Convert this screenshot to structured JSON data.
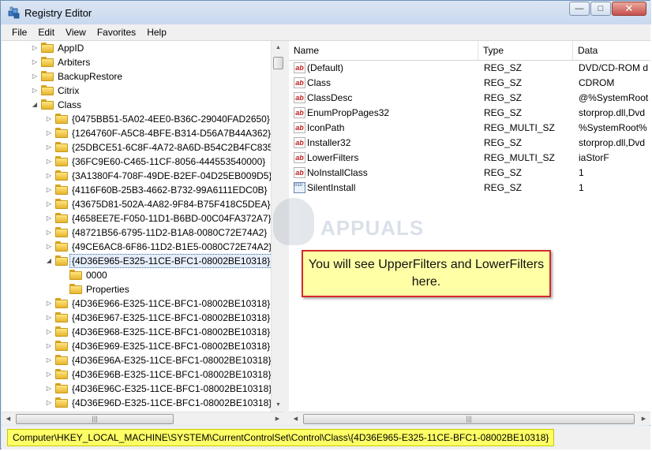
{
  "window": {
    "title": "Registry Editor",
    "icon": "registry-cube-icon",
    "minimize_icon": "minimize-icon",
    "maximize_icon": "maximize-icon",
    "close_icon": "close-icon"
  },
  "menu": [
    "File",
    "Edit",
    "View",
    "Favorites",
    "Help"
  ],
  "tree": {
    "nodes": [
      {
        "label": "AppID",
        "level": 0,
        "expanded": false
      },
      {
        "label": "Arbiters",
        "level": 0,
        "expanded": false
      },
      {
        "label": "BackupRestore",
        "level": 0,
        "expanded": false
      },
      {
        "label": "Citrix",
        "level": 0,
        "expanded": false
      },
      {
        "label": "Class",
        "level": 0,
        "expanded": true
      },
      {
        "label": "{0475BB51-5A02-4EE0-B36C-29040FAD2650}",
        "level": 1,
        "expanded": false
      },
      {
        "label": "{1264760F-A5C8-4BFE-B314-D56A7B44A362}",
        "level": 1,
        "expanded": false
      },
      {
        "label": "{25DBCE51-6C8F-4A72-8A6D-B54C2B4FC835}",
        "level": 1,
        "expanded": false
      },
      {
        "label": "{36FC9E60-C465-11CF-8056-444553540000}",
        "level": 1,
        "expanded": false
      },
      {
        "label": "{3A1380F4-708F-49DE-B2EF-04D25EB009D5}",
        "level": 1,
        "expanded": false
      },
      {
        "label": "{4116F60B-25B3-4662-B732-99A6111EDC0B}",
        "level": 1,
        "expanded": false
      },
      {
        "label": "{43675D81-502A-4A82-9F84-B75F418C5DEA}",
        "level": 1,
        "expanded": false
      },
      {
        "label": "{4658EE7E-F050-11D1-B6BD-00C04FA372A7}",
        "level": 1,
        "expanded": false
      },
      {
        "label": "{48721B56-6795-11D2-B1A8-0080C72E74A2}",
        "level": 1,
        "expanded": false
      },
      {
        "label": "{49CE6AC8-6F86-11D2-B1E5-0080C72E74A2}",
        "level": 1,
        "expanded": false
      },
      {
        "label": "{4D36E965-E325-11CE-BFC1-08002BE10318}",
        "level": 1,
        "expanded": true,
        "selected": true
      },
      {
        "label": "0000",
        "level": 2,
        "leaf": true
      },
      {
        "label": "Properties",
        "level": 2,
        "leaf": true
      },
      {
        "label": "{4D36E966-E325-11CE-BFC1-08002BE10318}",
        "level": 1,
        "expanded": false
      },
      {
        "label": "{4D36E967-E325-11CE-BFC1-08002BE10318}",
        "level": 1,
        "expanded": false
      },
      {
        "label": "{4D36E968-E325-11CE-BFC1-08002BE10318}",
        "level": 1,
        "expanded": false
      },
      {
        "label": "{4D36E969-E325-11CE-BFC1-08002BE10318}",
        "level": 1,
        "expanded": false
      },
      {
        "label": "{4D36E96A-E325-11CE-BFC1-08002BE10318}",
        "level": 1,
        "expanded": false
      },
      {
        "label": "{4D36E96B-E325-11CE-BFC1-08002BE10318}",
        "level": 1,
        "expanded": false
      },
      {
        "label": "{4D36E96C-E325-11CE-BFC1-08002BE10318}",
        "level": 1,
        "expanded": false
      },
      {
        "label": "{4D36E96D-E325-11CE-BFC1-08002BE10318}",
        "level": 1,
        "expanded": false
      }
    ]
  },
  "values": {
    "columns": [
      "Name",
      "Type",
      "Data"
    ],
    "rows": [
      {
        "name": "(Default)",
        "type": "REG_SZ",
        "data": "DVD/CD-ROM d",
        "icon": "string-value-icon"
      },
      {
        "name": "Class",
        "type": "REG_SZ",
        "data": "CDROM",
        "icon": "string-value-icon"
      },
      {
        "name": "ClassDesc",
        "type": "REG_SZ",
        "data": "@%SystemRoot",
        "icon": "string-value-icon"
      },
      {
        "name": "EnumPropPages32",
        "type": "REG_SZ",
        "data": "storprop.dll,Dvd",
        "icon": "string-value-icon"
      },
      {
        "name": "IconPath",
        "type": "REG_MULTI_SZ",
        "data": "%SystemRoot%",
        "icon": "string-value-icon"
      },
      {
        "name": "Installer32",
        "type": "REG_SZ",
        "data": "storprop.dll,Dvd",
        "icon": "string-value-icon"
      },
      {
        "name": "LowerFilters",
        "type": "REG_MULTI_SZ",
        "data": "iaStorF",
        "icon": "string-value-icon"
      },
      {
        "name": "NoInstallClass",
        "type": "REG_SZ",
        "data": "1",
        "icon": "string-value-icon"
      },
      {
        "name": "SilentInstall",
        "type": "REG_SZ",
        "data": "1",
        "icon": "binary-value-icon"
      }
    ]
  },
  "annotation": {
    "text": "You will see UpperFilters and LowerFilters here."
  },
  "status": {
    "path": "Computer\\HKEY_LOCAL_MACHINE\\SYSTEM\\CurrentControlSet\\Control\\Class\\{4D36E965-E325-11CE-BFC1-08002BE10318}"
  },
  "watermark": {
    "text": "APPUALS"
  },
  "colors": {
    "callout_border": "#d42a2a",
    "callout_fill": "#ffffa6",
    "status_highlight": "#ffff66",
    "string_icon": "#c41c1c"
  }
}
